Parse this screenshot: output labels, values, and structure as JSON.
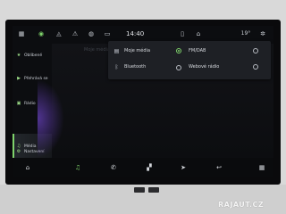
{
  "status_bar": {
    "time": "14:40",
    "temperature": "19°",
    "icons": [
      "grid-icon",
      "connectivity-icon",
      "power-icon",
      "warning-icon",
      "driver-icon",
      "battery-icon",
      "sd-icon",
      "home-icon"
    ]
  },
  "sidebar": {
    "items": [
      {
        "label": "Oblíbené",
        "icon": "star-icon"
      },
      {
        "label": "Přehrává se",
        "icon": "play-icon"
      },
      {
        "label": "Rádio",
        "icon": "radio-icon"
      },
      {
        "label": "Média",
        "icon": "music-icon"
      },
      {
        "label": "Nastavení",
        "icon": "gear-icon"
      }
    ],
    "active": "Média"
  },
  "main": {
    "ghost_title": "Moje média"
  },
  "source_menu": {
    "options": [
      {
        "label": "Moje média",
        "icon": "file-icon",
        "selected": false
      },
      {
        "label": "FM/DAB",
        "selected": true
      },
      {
        "label": "Bluetooth",
        "icon": "bluetooth-icon",
        "selected": false
      },
      {
        "label": "Webové rádio",
        "selected": false
      }
    ]
  },
  "dock": {
    "icons": [
      "home-icon",
      "music-icon",
      "phone-icon",
      "apps-icon",
      "navigation-icon",
      "return-icon",
      "grid-icon"
    ]
  },
  "colors": {
    "accent": "#7fd36b",
    "panel": "#1e2025",
    "screen": "#0c0d10"
  },
  "watermark": "RAJAUT.CZ"
}
